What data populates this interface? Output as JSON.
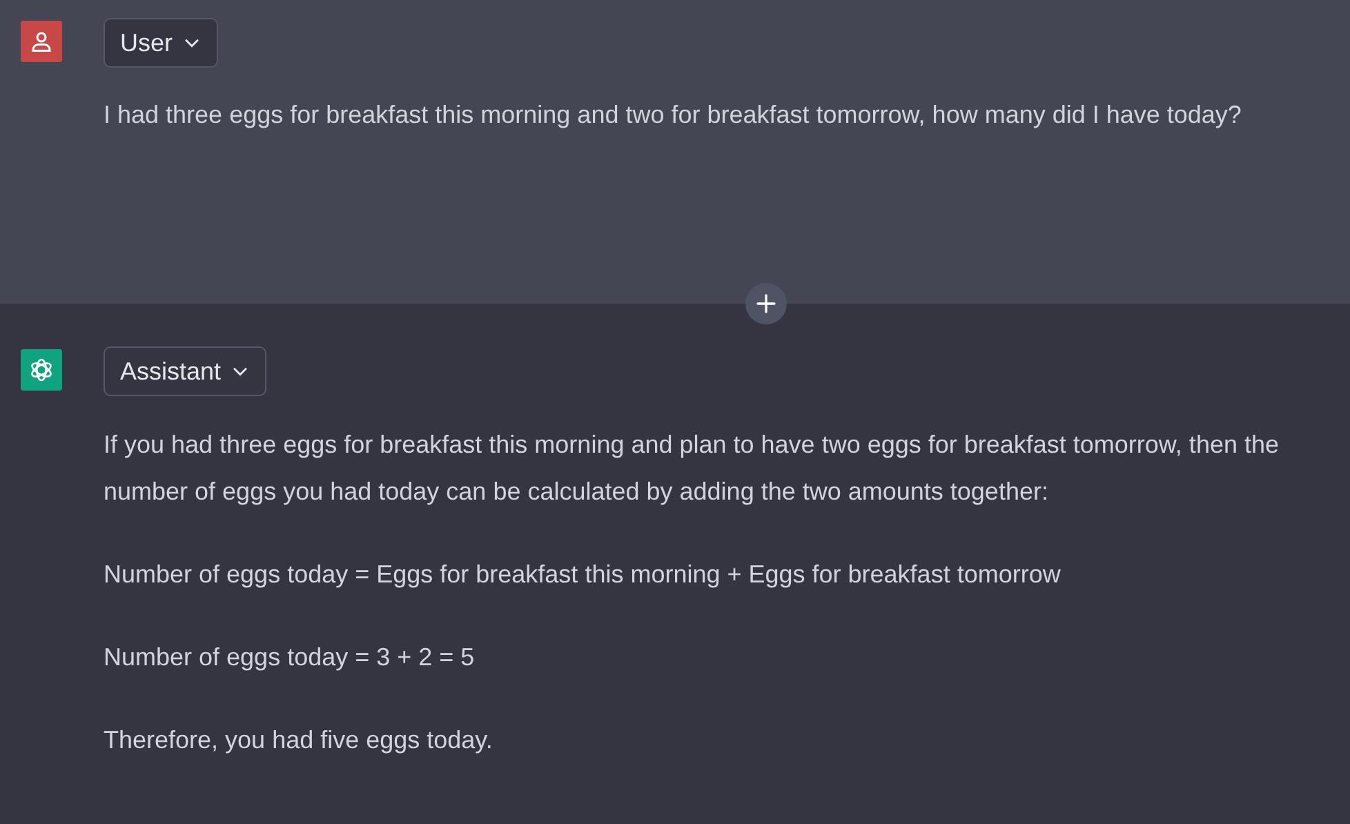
{
  "messages": [
    {
      "kind": "user",
      "role": "User",
      "paragraphs": [
        "I had three eggs for breakfast this morning and two for breakfast tomorrow, how many did I have today?"
      ]
    },
    {
      "kind": "assistant",
      "role": "Assistant",
      "paragraphs": [
        "If you had three eggs for breakfast this morning and plan to have two eggs for breakfast tomorrow, then the number of eggs you had today can be calculated by adding the two amounts together:",
        "Number of eggs today = Eggs for breakfast this morning + Eggs for breakfast tomorrow",
        "Number of eggs today = 3 + 2 = 5",
        "Therefore, you had five eggs today."
      ]
    }
  ]
}
